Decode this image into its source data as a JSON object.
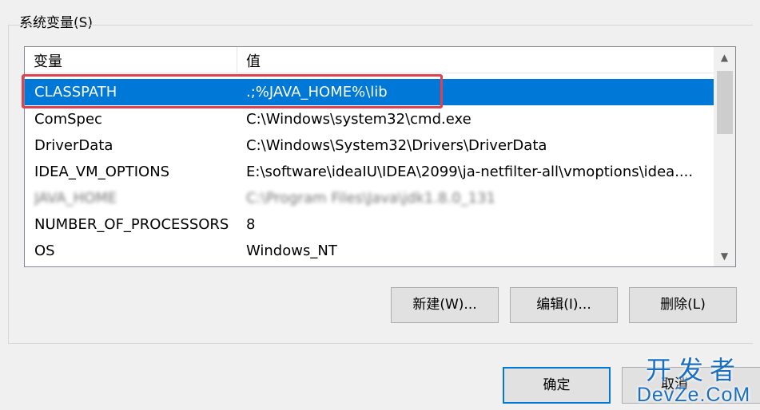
{
  "group": {
    "title": "系统变量(S)"
  },
  "list": {
    "columns": {
      "variable": "变量",
      "value": "值"
    },
    "rows": [
      {
        "name": "CLASSPATH",
        "value": ".;%JAVA_HOME%\\lib",
        "selected": true
      },
      {
        "name": "ComSpec",
        "value": "C:\\Windows\\system32\\cmd.exe"
      },
      {
        "name": "DriverData",
        "value": "C:\\Windows\\System32\\Drivers\\DriverData"
      },
      {
        "name": "IDEA_VM_OPTIONS",
        "value": "E:\\software\\ideaIU\\IDEA\\2099\\ja-netfilter-all\\vmoptions\\idea...."
      },
      {
        "name": "JAVA_HOME",
        "value": "C:\\Program Files\\Java\\jdk1.8.0_131",
        "blurred": true
      },
      {
        "name": "NUMBER_OF_PROCESSORS",
        "value": "8"
      },
      {
        "name": "OS",
        "value": "Windows_NT"
      }
    ]
  },
  "buttons": {
    "new": "新建(W)...",
    "edit": "编辑(I)...",
    "delete": "删除(L)",
    "ok": "确定",
    "cancel": "取消"
  },
  "watermark": {
    "top": "开发者",
    "bottom": "DevZe.CoM"
  },
  "colors": {
    "selection": "#0078d7",
    "highlight_box": "#e0414f",
    "watermark": "#1b6fc0"
  }
}
